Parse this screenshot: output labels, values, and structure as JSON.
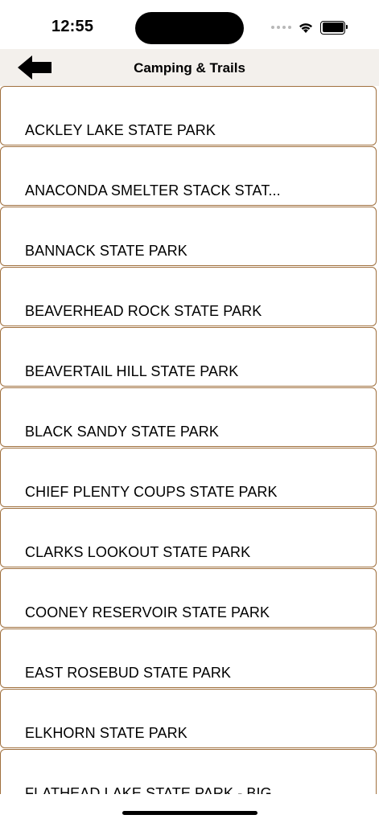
{
  "status_bar": {
    "time": "12:55"
  },
  "nav": {
    "title": "Camping & Trails",
    "back_icon": "arrow-left-icon"
  },
  "parks": [
    "ACKLEY LAKE STATE PARK",
    "ANACONDA SMELTER STACK STAT...",
    "BANNACK STATE PARK",
    "BEAVERHEAD ROCK STATE PARK",
    "BEAVERTAIL HILL STATE PARK",
    "BLACK SANDY STATE PARK",
    "CHIEF PLENTY COUPS STATE PARK",
    "CLARKS LOOKOUT STATE PARK",
    "COONEY RESERVOIR STATE PARK",
    "EAST ROSEBUD STATE PARK",
    "ELKHORN STATE PARK",
    "FLATHEAD LAKE STATE PARK - BIG"
  ],
  "colors": {
    "item_border": "#a0703e",
    "nav_background": "#f3f0ec"
  }
}
